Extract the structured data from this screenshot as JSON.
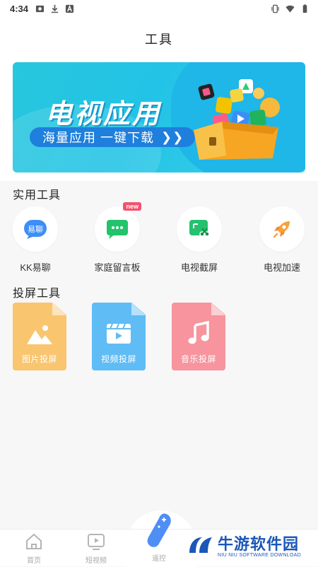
{
  "status_bar": {
    "time": "4:34",
    "icons_left": [
      "image-icon",
      "download-icon",
      "a-badge-icon"
    ],
    "icons_right": [
      "vibrate-icon",
      "wifi-icon",
      "battery-icon"
    ]
  },
  "header": {
    "title": "工具"
  },
  "banner": {
    "headline": "电视应用",
    "subline": "海量应用 一键下载",
    "chevron": "❯❯"
  },
  "practical_tools": {
    "title": "实用工具",
    "items": [
      {
        "label": "KK易聊",
        "icon": "kk-chat-icon",
        "icon_text": "易聊"
      },
      {
        "label": "家庭留言板",
        "icon": "message-board-icon",
        "badge": "new"
      },
      {
        "label": "电视截屏",
        "icon": "tv-screenshot-icon"
      },
      {
        "label": "电视加速",
        "icon": "rocket-icon"
      }
    ]
  },
  "cast_tools": {
    "title": "投屏工具",
    "items": [
      {
        "label": "图片投屏",
        "icon": "image-icon",
        "color": "#f9c56f"
      },
      {
        "label": "视频投屏",
        "icon": "video-icon",
        "color": "#5fbcf5"
      },
      {
        "label": "音乐投屏",
        "icon": "music-icon",
        "color": "#f7949d"
      }
    ]
  },
  "bottom_nav": {
    "items": [
      {
        "label": "首页",
        "icon": "home-icon"
      },
      {
        "label": "短视频",
        "icon": "short-video-icon"
      },
      {
        "label": "遥控",
        "icon": "remote-icon"
      }
    ]
  },
  "watermark": {
    "cn": "牛游软件园",
    "en": "NIU NIU SOFTWARE DOWNLOAD"
  },
  "colors": {
    "accent_blue": "#1e7fdc",
    "badge_red": "#f5516c"
  }
}
